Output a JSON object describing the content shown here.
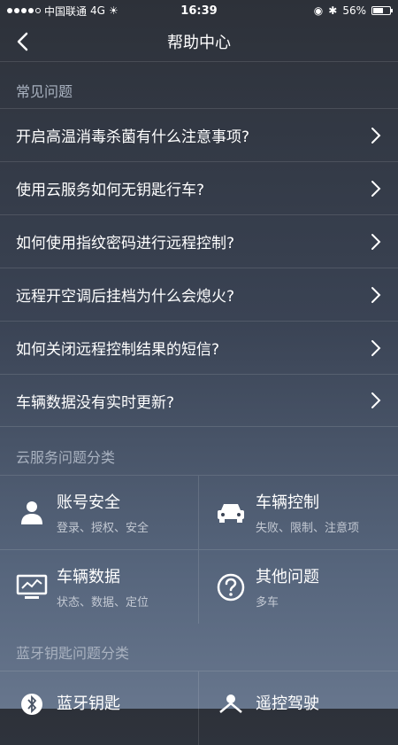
{
  "status_bar": {
    "carrier": "中国联通",
    "network": "4G",
    "time": "16:39",
    "battery": "56%",
    "battery_level": 0.56
  },
  "nav": {
    "title": "帮助中心",
    "back_icon": "chevron-left-icon"
  },
  "faq": {
    "section_title": "常见问题",
    "items": [
      {
        "label": "开启高温消毒杀菌有什么注意事项?"
      },
      {
        "label": "使用云服务如何无钥匙行车?"
      },
      {
        "label": "如何使用指纹密码进行远程控制?"
      },
      {
        "label": "远程开空调后挂档为什么会熄火?"
      },
      {
        "label": "如何关闭远程控制结果的短信?"
      },
      {
        "label": "车辆数据没有实时更新?"
      }
    ]
  },
  "cloud_categories": {
    "section_title": "云服务问题分类",
    "items": [
      {
        "title": "账号安全",
        "subtitle": "登录、授权、安全",
        "icon": "user-icon"
      },
      {
        "title": "车辆控制",
        "subtitle": "失败、限制、注意项",
        "icon": "car-icon"
      },
      {
        "title": "车辆数据",
        "subtitle": "状态、数据、定位",
        "icon": "monitor-chart-icon"
      },
      {
        "title": "其他问题",
        "subtitle": "多车",
        "icon": "question-circle-icon"
      }
    ]
  },
  "bluetooth_categories": {
    "section_title": "蓝牙钥匙问题分类",
    "items": [
      {
        "title": "蓝牙钥匙",
        "icon": "bluetooth-icon"
      },
      {
        "title": "遥控驾驶",
        "icon": "remote-drive-icon"
      }
    ]
  }
}
